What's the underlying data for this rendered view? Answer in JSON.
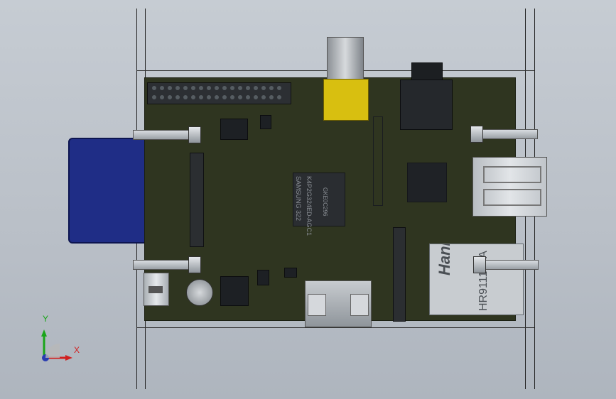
{
  "chip_a_text": [
    "SAMSUNG 322",
    "K4P2G324ED-AGC1",
    "GKE0C296"
  ],
  "ethernet": {
    "brand": "HanRun",
    "part": "HR911105A"
  },
  "axes": {
    "y": "Y",
    "x": "X"
  },
  "colors": {
    "board": "#2f3520",
    "sd_card": "#1f2d86",
    "rca": "#d8bf10",
    "usb": "#d7dbdf",
    "ethernet": "#c8ccd0"
  }
}
